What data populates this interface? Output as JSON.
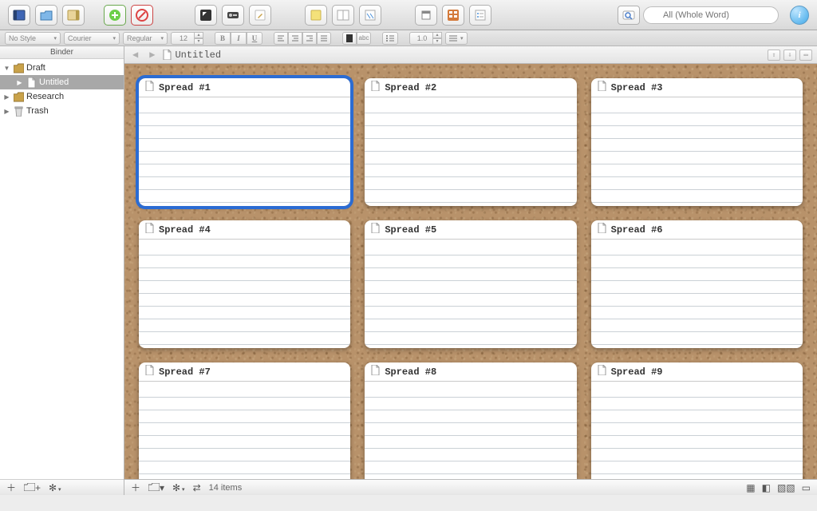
{
  "toolbar": {
    "search_placeholder": "All (Whole Word)"
  },
  "formatbar": {
    "style": "No Style",
    "font": "Courier",
    "variant": "Regular",
    "size": "12",
    "spacing": "1.0"
  },
  "sidebar": {
    "header": "Binder",
    "items": [
      {
        "label": "Draft",
        "indent": 0,
        "disclosure": "▼",
        "icon": "folder",
        "selected": false
      },
      {
        "label": "Untitled",
        "indent": 1,
        "disclosure": "▶",
        "icon": "doc",
        "selected": true
      },
      {
        "label": "Research",
        "indent": 0,
        "disclosure": "▶",
        "icon": "folder",
        "selected": false
      },
      {
        "label": "Trash",
        "indent": 0,
        "disclosure": "▶",
        "icon": "trash",
        "selected": false
      }
    ]
  },
  "nav": {
    "title": "Untitled"
  },
  "cards": [
    {
      "title": "Spread #1",
      "selected": true
    },
    {
      "title": "Spread #2",
      "selected": false
    },
    {
      "title": "Spread #3",
      "selected": false
    },
    {
      "title": "Spread #4",
      "selected": false
    },
    {
      "title": "Spread #5",
      "selected": false
    },
    {
      "title": "Spread #6",
      "selected": false
    },
    {
      "title": "Spread #7",
      "selected": false
    },
    {
      "title": "Spread #8",
      "selected": false
    },
    {
      "title": "Spread #9",
      "selected": false
    }
  ],
  "footer": {
    "count": "14 items"
  }
}
